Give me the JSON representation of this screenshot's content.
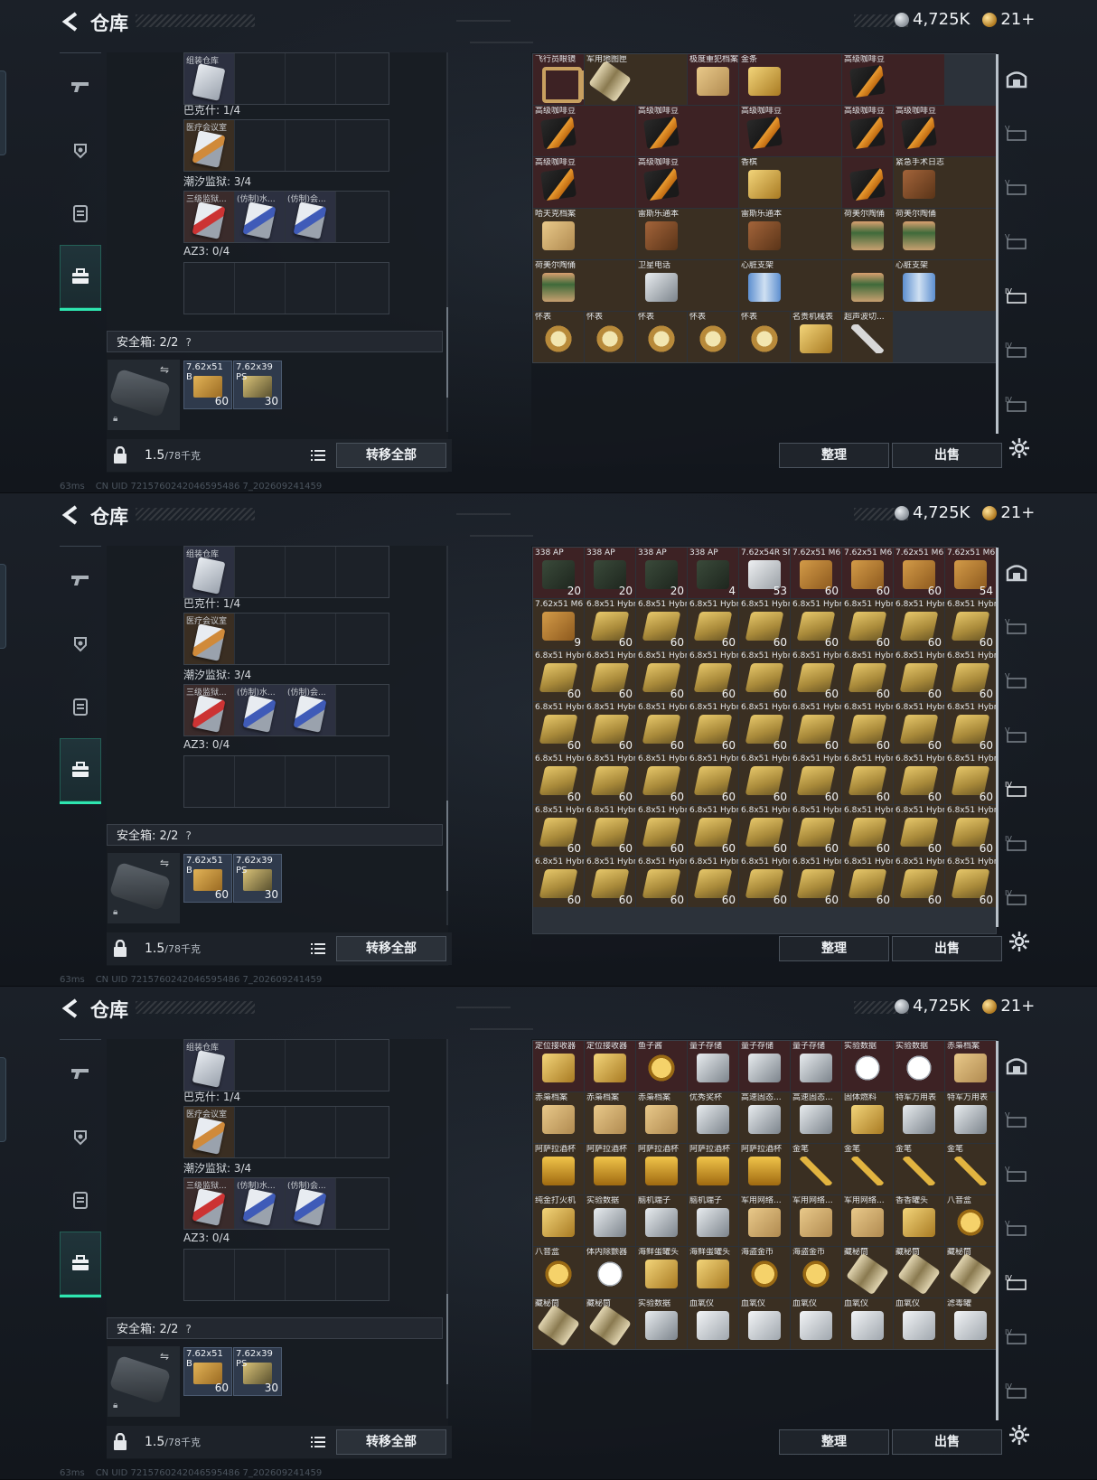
{
  "header": {
    "title": "仓库",
    "silver": "4,725K",
    "gold": "21+"
  },
  "left": {
    "group0_label": "组装仓库",
    "group1_label": "巴克什: 1/4",
    "group1_cell": "医疗会议室",
    "group2_label": "潮汐监狱: 3/4",
    "group2_cells": [
      "三级监狱...",
      "(仿制)水...",
      "(仿制)会..."
    ],
    "group3_label": "AZ3: 0/4",
    "safebox_label": "安全箱: 2/2",
    "safebox_q": "?",
    "ammo": [
      {
        "label": "7.62x51",
        "sub": "B",
        "count": "60"
      },
      {
        "label": "7.62x39",
        "sub": "PS",
        "count": "30"
      }
    ],
    "weight_value": "1.5",
    "weight_unit": "/78千克",
    "transfer_label": "转移全部"
  },
  "right": {
    "sort_label": "整理",
    "sell_label": "出售"
  },
  "status": {
    "fps": "63ms",
    "uid": "CN UID 7215760242046595486 7_202609241459"
  },
  "screen1_items": [
    {
      "label": "飞行员眼镜",
      "shape": "glasses",
      "bg": "red"
    },
    {
      "label": "军用地图匣",
      "shape": "tube",
      "bg": "brown",
      "wide": 3
    },
    {
      "label": "极度重犯档案",
      "shape": "doc",
      "bg": "red"
    },
    {
      "label": "金条",
      "shape": "gold",
      "bg": "red",
      "wide": 2
    },
    {
      "label": "高级咖啡豆",
      "shape": "coffee",
      "bg": "red",
      "wide": 2
    },
    {
      "label": "高级咖啡豆",
      "shape": "coffee",
      "bg": "red",
      "wide": 2
    },
    {
      "label": "高级咖啡豆",
      "shape": "coffee",
      "bg": "red",
      "wide": 2
    },
    {
      "label": "高级咖啡豆",
      "shape": "coffee",
      "bg": "red",
      "wide": 2
    },
    {
      "label": "高级咖啡豆",
      "shape": "coffee",
      "bg": "red"
    },
    {
      "label": "高级咖啡豆",
      "shape": "coffee",
      "bg": "red",
      "wide": 2
    },
    {
      "label": "高级咖啡豆",
      "shape": "coffee",
      "bg": "red",
      "wide": 2
    },
    {
      "label": "高级咖啡豆",
      "shape": "coffee",
      "bg": "red",
      "wide": 2
    },
    {
      "label": "香槟",
      "shape": "gold",
      "bg": "brown",
      "wide": 2
    },
    {
      "label": "",
      "shape": "coffee",
      "bg": "red"
    },
    {
      "label": "紧急手术日志",
      "shape": "wallet",
      "bg": "brown",
      "wide": 2
    },
    {
      "label": "哈夫克档案",
      "shape": "doc",
      "bg": "brown",
      "wide": 2
    },
    {
      "label": "雷斯乐通本",
      "shape": "wallet",
      "bg": "brown",
      "wide": 2
    },
    {
      "label": "雷斯乐通本",
      "shape": "wallet",
      "bg": "brown",
      "wide": 2
    },
    {
      "label": "荷美尔陶俑",
      "shape": "figure",
      "bg": "brown"
    },
    {
      "label": "荷美尔陶俑",
      "shape": "figure",
      "bg": "brown",
      "wide": 2
    },
    {
      "label": "荷美尔陶俑",
      "shape": "figure",
      "bg": "brown",
      "wide": 2
    },
    {
      "label": "卫星电话",
      "shape": "silver",
      "bg": "brown",
      "wide": 2
    },
    {
      "label": "心脏支架",
      "shape": "bluepack",
      "bg": "brown",
      "wide": 2
    },
    {
      "label": "",
      "shape": "figure",
      "bg": "brown"
    },
    {
      "label": "心脏支架",
      "shape": "bluepack",
      "bg": "brown",
      "wide": 2
    },
    {
      "label": "怀表",
      "shape": "watch",
      "bg": "brown"
    },
    {
      "label": "怀表",
      "shape": "watch",
      "bg": "brown"
    },
    {
      "label": "怀表",
      "shape": "watch",
      "bg": "brown"
    },
    {
      "label": "怀表",
      "shape": "watch",
      "bg": "brown"
    },
    {
      "label": "怀表",
      "shape": "watch",
      "bg": "brown"
    },
    {
      "label": "名贵机械表",
      "shape": "gold",
      "bg": "brown"
    },
    {
      "label": "超声波切...",
      "shape": "pen",
      "bg": "brown"
    }
  ],
  "screen2_items": [
    {
      "label": "338 AP",
      "count": "20",
      "shape": "ammo-dark",
      "bg": "red"
    },
    {
      "label": "338 AP",
      "count": "20",
      "shape": "ammo-dark",
      "bg": "red"
    },
    {
      "label": "338 AP",
      "count": "20",
      "shape": "ammo-dark",
      "bg": "red"
    },
    {
      "label": "338 AP",
      "count": "4",
      "shape": "ammo-dark",
      "bg": "red"
    },
    {
      "label": "7.62x54R SNB",
      "count": "53",
      "shape": "ammo-white",
      "bg": "red"
    },
    {
      "label": "7.62x51 M61",
      "count": "60",
      "shape": "ammo-brown",
      "bg": "red"
    },
    {
      "label": "7.62x51 M61",
      "count": "60",
      "shape": "ammo-brown",
      "bg": "red"
    },
    {
      "label": "7.62x51 M61",
      "count": "60",
      "shape": "ammo-brown",
      "bg": "red"
    },
    {
      "label": "7.62x51 M61",
      "count": "54",
      "shape": "ammo-brown",
      "bg": "red"
    },
    {
      "label": "7.62x51 M61",
      "count": "9",
      "shape": "ammo-brown",
      "bg": "brown"
    },
    {
      "label": "6.8x51 Hybrid",
      "count": "60",
      "shape": "ammo-gold",
      "bg": "brown"
    },
    {
      "label": "6.8x51 Hybrid",
      "count": "60",
      "shape": "ammo-gold",
      "bg": "brown"
    },
    {
      "label": "6.8x51 Hybrid",
      "count": "60",
      "shape": "ammo-gold",
      "bg": "brown"
    },
    {
      "label": "6.8x51 Hybrid",
      "count": "60",
      "shape": "ammo-gold",
      "bg": "brown"
    },
    {
      "label": "6.8x51 Hybrid",
      "count": "60",
      "shape": "ammo-gold",
      "bg": "brown"
    },
    {
      "label": "6.8x51 Hybrid",
      "count": "60",
      "shape": "ammo-gold",
      "bg": "brown"
    },
    {
      "label": "6.8x51 Hybrid",
      "count": "60",
      "shape": "ammo-gold",
      "bg": "brown"
    },
    {
      "label": "6.8x51 Hybrid",
      "count": "60",
      "shape": "ammo-gold",
      "bg": "brown"
    }
  ],
  "screen2_repeat_label": "6.8x51 Hybrid",
  "screen2_repeat_count": "60",
  "screen3_items": [
    {
      "label": "定位接收器",
      "shape": "gold",
      "bg": "red"
    },
    {
      "label": "定位接收器",
      "shape": "gold",
      "bg": "red"
    },
    {
      "label": "鱼子酱",
      "shape": "coin",
      "bg": "red"
    },
    {
      "label": "量子存储",
      "shape": "silver",
      "bg": "red"
    },
    {
      "label": "量子存储",
      "shape": "silver",
      "bg": "red"
    },
    {
      "label": "量子存储",
      "shape": "silver",
      "bg": "red"
    },
    {
      "label": "实验数据",
      "shape": "whitedisk",
      "bg": "red"
    },
    {
      "label": "实验数据",
      "shape": "whitedisk",
      "bg": "red"
    },
    {
      "label": "赤枭档案",
      "shape": "doc",
      "bg": "red"
    },
    {
      "label": "赤枭档案",
      "shape": "doc",
      "bg": "brown"
    },
    {
      "label": "赤枭档案",
      "shape": "doc",
      "bg": "brown"
    },
    {
      "label": "赤枭档案",
      "shape": "doc",
      "bg": "brown"
    },
    {
      "label": "优秀奖杯",
      "shape": "silver",
      "bg": "brown"
    },
    {
      "label": "高速固态...",
      "shape": "silver",
      "bg": "brown"
    },
    {
      "label": "高速固态...",
      "shape": "silver",
      "bg": "brown"
    },
    {
      "label": "固体燃料",
      "shape": "gold",
      "bg": "brown"
    },
    {
      "label": "特军万用表",
      "shape": "silver",
      "bg": "brown"
    },
    {
      "label": "特军万用表",
      "shape": "silver",
      "bg": "brown"
    },
    {
      "label": "阿萨拉酒杯",
      "shape": "cup",
      "bg": "brown"
    },
    {
      "label": "阿萨拉酒杯",
      "shape": "cup",
      "bg": "brown"
    },
    {
      "label": "阿萨拉酒杯",
      "shape": "cup",
      "bg": "brown"
    },
    {
      "label": "阿萨拉酒杯",
      "shape": "cup",
      "bg": "brown"
    },
    {
      "label": "阿萨拉酒杯",
      "shape": "cup",
      "bg": "brown"
    },
    {
      "label": "金笔",
      "shape": "goldpen",
      "bg": "brown"
    },
    {
      "label": "金笔",
      "shape": "goldpen",
      "bg": "brown"
    },
    {
      "label": "金笔",
      "shape": "goldpen",
      "bg": "brown"
    },
    {
      "label": "金笔",
      "shape": "goldpen",
      "bg": "brown"
    },
    {
      "label": "纯金打火机",
      "shape": "gold",
      "bg": "brown"
    },
    {
      "label": "实验数据",
      "shape": "silver",
      "bg": "brown"
    },
    {
      "label": "脑机端子",
      "shape": "silver",
      "bg": "brown"
    },
    {
      "label": "脑机端子",
      "shape": "silver",
      "bg": "brown"
    },
    {
      "label": "军用网络...",
      "shape": "doc",
      "bg": "brown"
    },
    {
      "label": "军用网络...",
      "shape": "doc",
      "bg": "brown"
    },
    {
      "label": "军用网络...",
      "shape": "doc",
      "bg": "brown"
    },
    {
      "label": "香香罐头",
      "shape": "gold",
      "bg": "brown"
    },
    {
      "label": "八音盒",
      "shape": "coin",
      "bg": "brown"
    },
    {
      "label": "八音盒",
      "shape": "coin",
      "bg": "brown"
    },
    {
      "label": "体内除颤器",
      "shape": "whitedisk",
      "bg": "brown"
    },
    {
      "label": "海鲜蛋罐头",
      "shape": "gold",
      "bg": "brown"
    },
    {
      "label": "海鲜蛋罐头",
      "shape": "gold",
      "bg": "brown"
    },
    {
      "label": "海盗金币",
      "shape": "coin",
      "bg": "brown"
    },
    {
      "label": "海盗金币",
      "shape": "coin",
      "bg": "brown"
    },
    {
      "label": "藏秘筒",
      "shape": "tube",
      "bg": "brown"
    },
    {
      "label": "藏秘筒",
      "shape": "tube",
      "bg": "brown"
    },
    {
      "label": "藏秘筒",
      "shape": "tube",
      "bg": "brown"
    },
    {
      "label": "藏秘筒",
      "shape": "tube",
      "bg": "brown"
    },
    {
      "label": "藏秘筒",
      "shape": "tube",
      "bg": "brown"
    },
    {
      "label": "实验数据",
      "shape": "silver",
      "bg": "brown"
    },
    {
      "label": "血氧仪",
      "shape": "device",
      "bg": "brown"
    },
    {
      "label": "血氧仪",
      "shape": "device",
      "bg": "brown"
    },
    {
      "label": "血氧仪",
      "shape": "device",
      "bg": "brown"
    },
    {
      "label": "血氧仪",
      "shape": "device",
      "bg": "brown"
    },
    {
      "label": "血氧仪",
      "shape": "device",
      "bg": "brown"
    },
    {
      "label": "滤毒罐",
      "shape": "device",
      "bg": "brown"
    }
  ]
}
